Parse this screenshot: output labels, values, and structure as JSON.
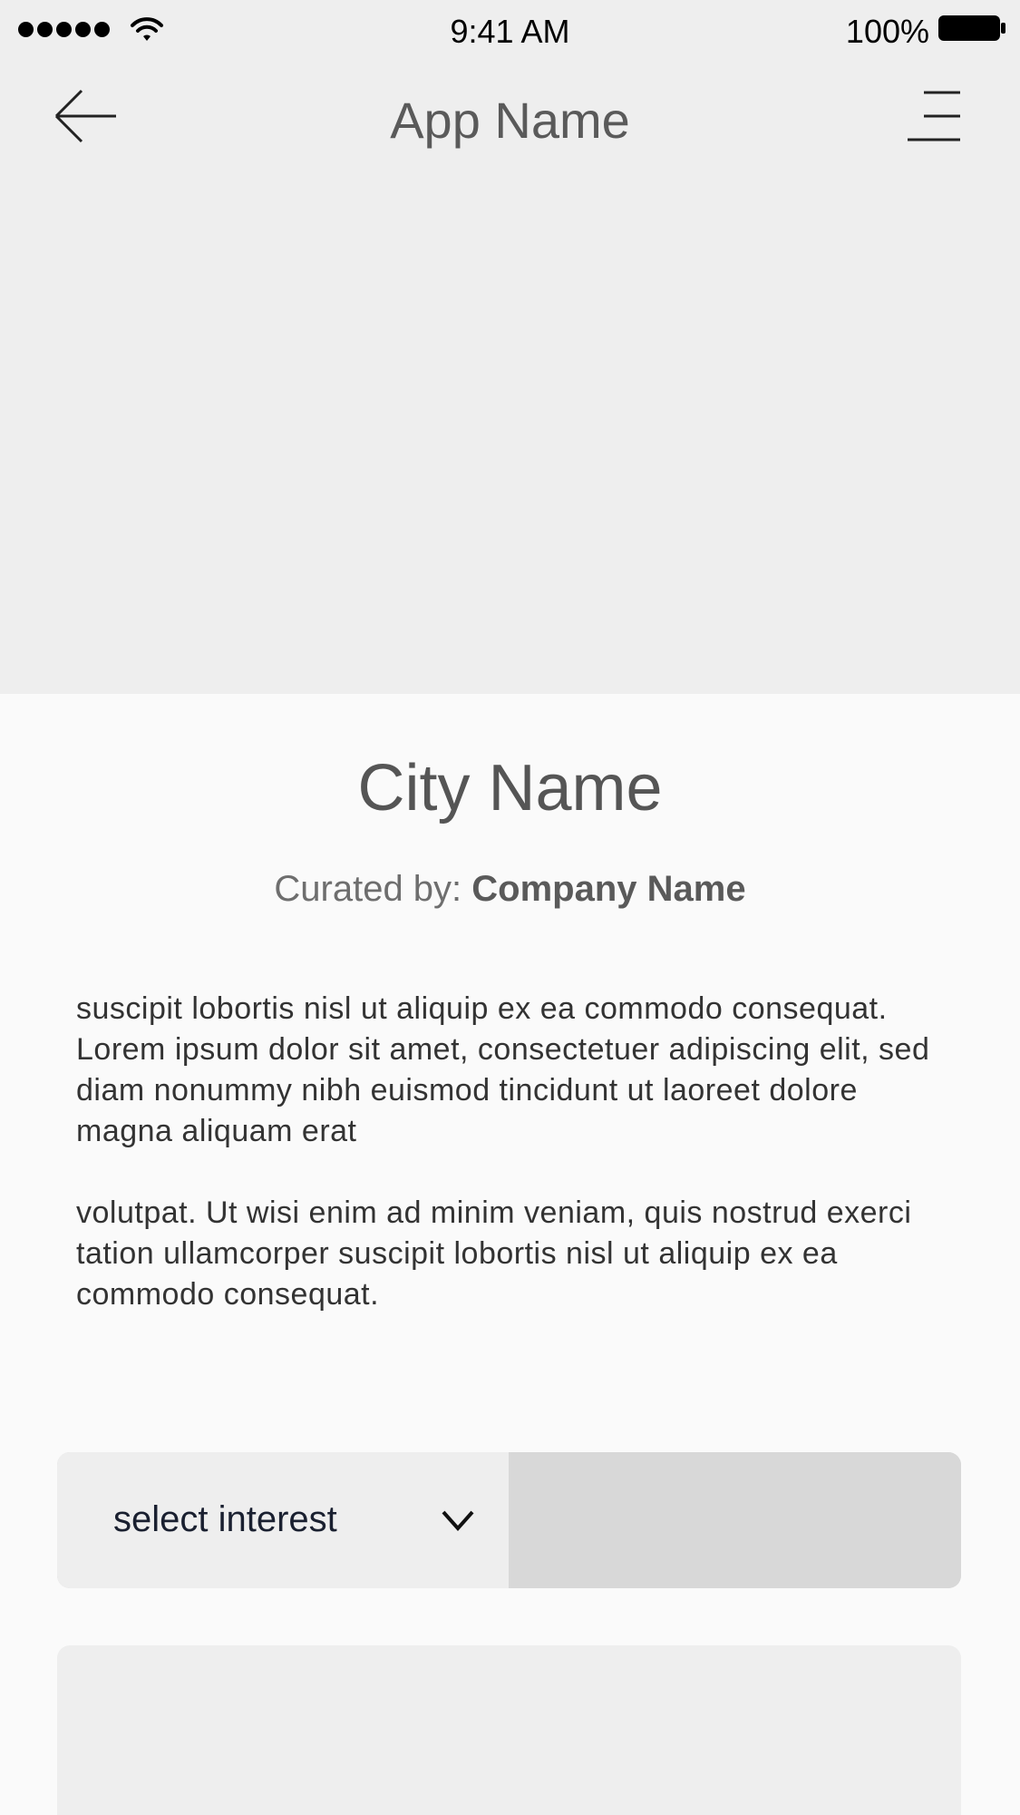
{
  "status_bar": {
    "time": "9:41 AM",
    "battery": "100%",
    "signal_icon": "signal-dots-icon",
    "wifi_icon": "wifi-icon",
    "battery_icon": "battery-icon"
  },
  "header": {
    "title": "App Name",
    "back_icon": "back-arrow-icon",
    "menu_icon": "menu-icon"
  },
  "main": {
    "city_name": "City Name",
    "curated_prefix": "Curated by: ",
    "company_name": "Company Name",
    "paragraphs": [
      "suscipit lobortis nisl ut aliquip ex ea commodo consequat.\nLorem ipsum dolor sit amet, consectetuer adipiscing elit, sed diam nonummy nibh euismod tincidunt ut laoreet dolore magna aliquam erat",
      "volutpat. Ut wisi enim ad minim veniam, quis nostrud exerci tation ullamcorper suscipit lobortis nisl ut aliquip ex ea commodo consequat."
    ]
  },
  "filter": {
    "select_label": "select interest",
    "chevron_icon": "chevron-down-icon"
  },
  "colors": {
    "header_bg": "#eeeeee",
    "page_bg": "#fafafa",
    "select_right_bg": "#d8d8d8",
    "title_text": "#5a5a5a"
  }
}
